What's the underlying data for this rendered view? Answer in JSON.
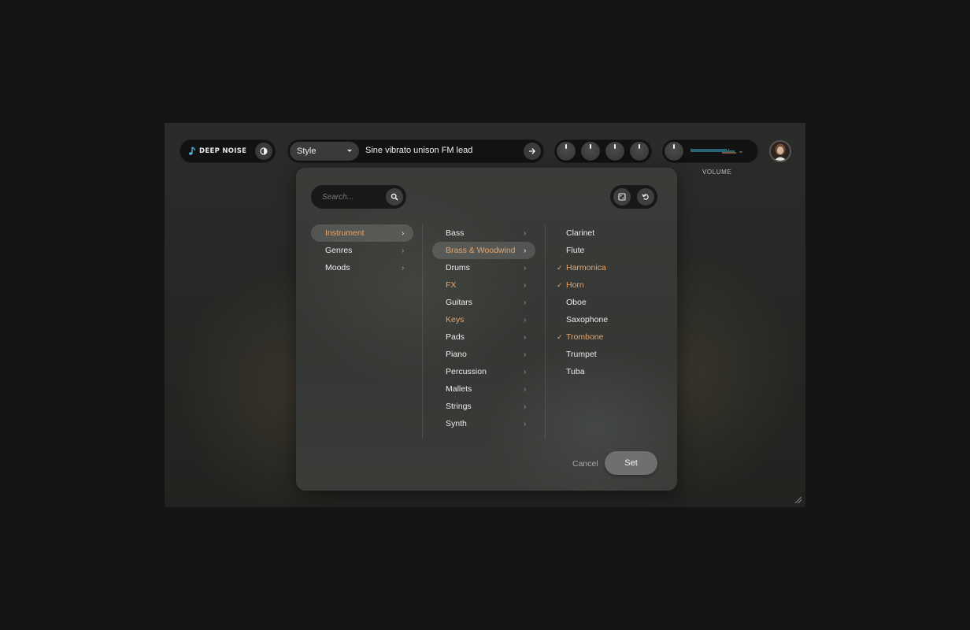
{
  "brand": {
    "name": "DEEP NOISE"
  },
  "prompt": {
    "style_label": "Style",
    "text": "Sine vibrato unison FM lead"
  },
  "volume": {
    "label": "VOLUME"
  },
  "search": {
    "placeholder": "Search..."
  },
  "categories": [
    {
      "label": "Instrument",
      "selected": true,
      "highlighted": true
    },
    {
      "label": "Genres",
      "selected": false,
      "highlighted": false
    },
    {
      "label": "Moods",
      "selected": false,
      "highlighted": false
    }
  ],
  "subcategories": [
    {
      "label": "Bass",
      "selected": false,
      "highlighted": false
    },
    {
      "label": "Brass & Woodwind",
      "selected": true,
      "highlighted": true
    },
    {
      "label": "Drums",
      "selected": false,
      "highlighted": false
    },
    {
      "label": "FX",
      "selected": false,
      "highlighted": true
    },
    {
      "label": "Guitars",
      "selected": false,
      "highlighted": false
    },
    {
      "label": "Keys",
      "selected": false,
      "highlighted": true
    },
    {
      "label": "Pads",
      "selected": false,
      "highlighted": false
    },
    {
      "label": "Piano",
      "selected": false,
      "highlighted": false
    },
    {
      "label": "Percussion",
      "selected": false,
      "highlighted": false
    },
    {
      "label": "Mallets",
      "selected": false,
      "highlighted": false
    },
    {
      "label": "Strings",
      "selected": false,
      "highlighted": false
    },
    {
      "label": "Synth",
      "selected": false,
      "highlighted": false
    }
  ],
  "instruments": [
    {
      "label": "Clarinet",
      "checked": false
    },
    {
      "label": "Flute",
      "checked": false
    },
    {
      "label": "Harmonica",
      "checked": true
    },
    {
      "label": "Horn",
      "checked": true
    },
    {
      "label": "Oboe",
      "checked": false
    },
    {
      "label": "Saxophone",
      "checked": false
    },
    {
      "label": "Trombone",
      "checked": true
    },
    {
      "label": "Trumpet",
      "checked": false
    },
    {
      "label": "Tuba",
      "checked": false
    }
  ],
  "footer": {
    "cancel_label": "Cancel",
    "set_label": "Set"
  },
  "icons": {
    "chevron": "›",
    "check": "✓"
  },
  "colors": {
    "accent": "#e8a46a",
    "meter_blue": "#3fb6d9",
    "meter_orange": "#e8a46a",
    "logo_blue": "#4fb3d9"
  }
}
